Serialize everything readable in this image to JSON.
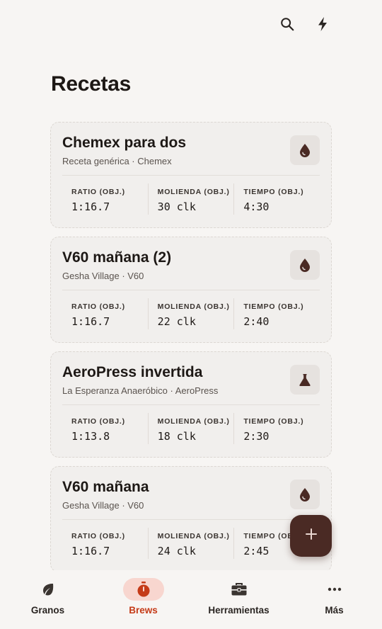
{
  "header": {
    "search_icon": "search-icon",
    "flash_icon": "lightning-bolt-icon"
  },
  "page": {
    "title": "Recetas"
  },
  "recipes": [
    {
      "title": "Chemex para dos",
      "subtitle": "Receta genérica · Chemex",
      "icon": "drop-icon",
      "stats": [
        {
          "label": "RATIO (OBJ.)",
          "value": "1:16.7"
        },
        {
          "label": "MOLIENDA (OBJ.)",
          "value": "30 clk"
        },
        {
          "label": "TIEMPO (OBJ.)",
          "value": "4:30"
        }
      ]
    },
    {
      "title": "V60 mañana (2)",
      "subtitle": "Gesha Village · V60",
      "icon": "drop-icon",
      "stats": [
        {
          "label": "RATIO (OBJ.)",
          "value": "1:16.7"
        },
        {
          "label": "MOLIENDA (OBJ.)",
          "value": "22 clk"
        },
        {
          "label": "TIEMPO (OBJ.)",
          "value": "2:40"
        }
      ]
    },
    {
      "title": "AeroPress invertida",
      "subtitle": "La Esperanza Anaeróbico · AeroPress",
      "icon": "flask-icon",
      "stats": [
        {
          "label": "RATIO (OBJ.)",
          "value": "1:13.8"
        },
        {
          "label": "MOLIENDA (OBJ.)",
          "value": "18 clk"
        },
        {
          "label": "TIEMPO (OBJ.)",
          "value": "2:30"
        }
      ]
    },
    {
      "title": "V60 mañana",
      "subtitle": "Gesha Village · V60",
      "icon": "drop-icon",
      "stats": [
        {
          "label": "RATIO (OBJ.)",
          "value": "1:16.7"
        },
        {
          "label": "MOLIENDA (OBJ.)",
          "value": "24 clk"
        },
        {
          "label": "TIEMPO (OBJ.)",
          "value": "2:45"
        }
      ]
    }
  ],
  "fab": {
    "icon": "plus-icon"
  },
  "nav": {
    "items": [
      {
        "label": "Granos",
        "icon": "leaf-icon",
        "active": false
      },
      {
        "label": "Brews",
        "icon": "stopwatch-icon",
        "active": true
      },
      {
        "label": "Herramientas",
        "icon": "toolbox-icon",
        "active": false
      },
      {
        "label": "Más",
        "icon": "more-dots-icon",
        "active": false
      }
    ]
  },
  "colors": {
    "accent": "#c53a17",
    "accent_pill": "#f8d6cf",
    "fab": "#4a2a24",
    "icon_dark": "#4a2a24"
  }
}
